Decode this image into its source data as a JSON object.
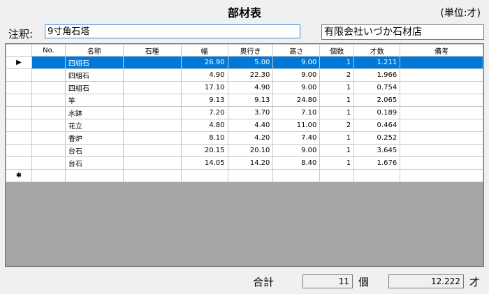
{
  "header": {
    "title": "部材表",
    "unit": "(単位:才)"
  },
  "note": {
    "label": "注釈:",
    "value": "9寸角石塔"
  },
  "company": "有限会社いづか石材店",
  "grid": {
    "columns": [
      "No.",
      "名称",
      "石種",
      "幅",
      "奥行き",
      "高さ",
      "個数",
      "才数",
      "備考"
    ],
    "new_row_marker": "✱",
    "current_row_marker": "▶",
    "rows": [
      {
        "no": "",
        "name": "四組石",
        "stone": "",
        "width": "26.90",
        "depth": "5.00",
        "height": "9.00",
        "count": "1",
        "sai": "1.211",
        "note": ""
      },
      {
        "no": "",
        "name": "四組石",
        "stone": "",
        "width": "4.90",
        "depth": "22.30",
        "height": "9.00",
        "count": "2",
        "sai": "1.966",
        "note": ""
      },
      {
        "no": "",
        "name": "四組石",
        "stone": "",
        "width": "17.10",
        "depth": "4.90",
        "height": "9.00",
        "count": "1",
        "sai": "0.754",
        "note": ""
      },
      {
        "no": "",
        "name": "竿",
        "stone": "",
        "width": "9.13",
        "depth": "9.13",
        "height": "24.80",
        "count": "1",
        "sai": "2.065",
        "note": ""
      },
      {
        "no": "",
        "name": "水鉢",
        "stone": "",
        "width": "7.20",
        "depth": "3.70",
        "height": "7.10",
        "count": "1",
        "sai": "0.189",
        "note": ""
      },
      {
        "no": "",
        "name": "花立",
        "stone": "",
        "width": "4.80",
        "depth": "4.40",
        "height": "11.00",
        "count": "2",
        "sai": "0.464",
        "note": ""
      },
      {
        "no": "",
        "name": "香炉",
        "stone": "",
        "width": "8.10",
        "depth": "4.20",
        "height": "7.40",
        "count": "1",
        "sai": "0.252",
        "note": ""
      },
      {
        "no": "",
        "name": "台石",
        "stone": "",
        "width": "20.15",
        "depth": "20.10",
        "height": "9.00",
        "count": "1",
        "sai": "3.645",
        "note": ""
      },
      {
        "no": "",
        "name": "台石",
        "stone": "",
        "width": "14.05",
        "depth": "14.20",
        "height": "8.40",
        "count": "1",
        "sai": "1.676",
        "note": ""
      }
    ]
  },
  "footer": {
    "total_label": "合計",
    "count_total": "11",
    "count_unit": "個",
    "sai_total": "12.222",
    "sai_unit": "才"
  },
  "colors": {
    "selection": "#0078d7",
    "input_focus_border": "#3c8dde",
    "grid_empty_area": "#a5a5a5"
  }
}
